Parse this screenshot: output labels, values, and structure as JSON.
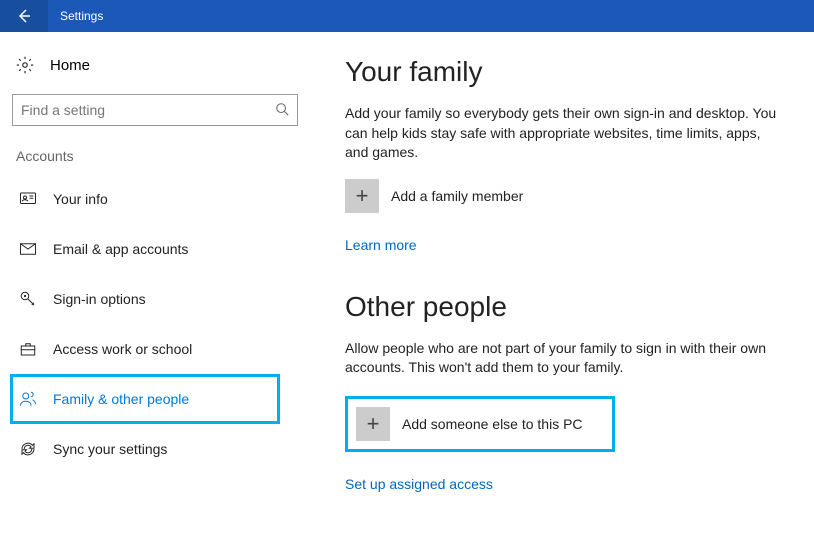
{
  "titlebar": {
    "title": "Settings"
  },
  "sidebar": {
    "home_label": "Home",
    "search_placeholder": "Find a setting",
    "category_label": "Accounts",
    "items": [
      {
        "label": "Your info"
      },
      {
        "label": "Email & app accounts"
      },
      {
        "label": "Sign-in options"
      },
      {
        "label": "Access work or school"
      },
      {
        "label": "Family & other people"
      },
      {
        "label": "Sync your settings"
      }
    ]
  },
  "main": {
    "family": {
      "title": "Your family",
      "desc": "Add your family so everybody gets their own sign-in and desktop. You can help kids stay safe with appropriate websites, time limits, apps, and games.",
      "add_label": "Add a family member",
      "learn_more": "Learn more"
    },
    "other": {
      "title": "Other people",
      "desc": "Allow people who are not part of your family to sign in with their own accounts. This won't add them to your family.",
      "add_label": "Add someone else to this PC",
      "assigned_access": "Set up assigned access"
    }
  }
}
